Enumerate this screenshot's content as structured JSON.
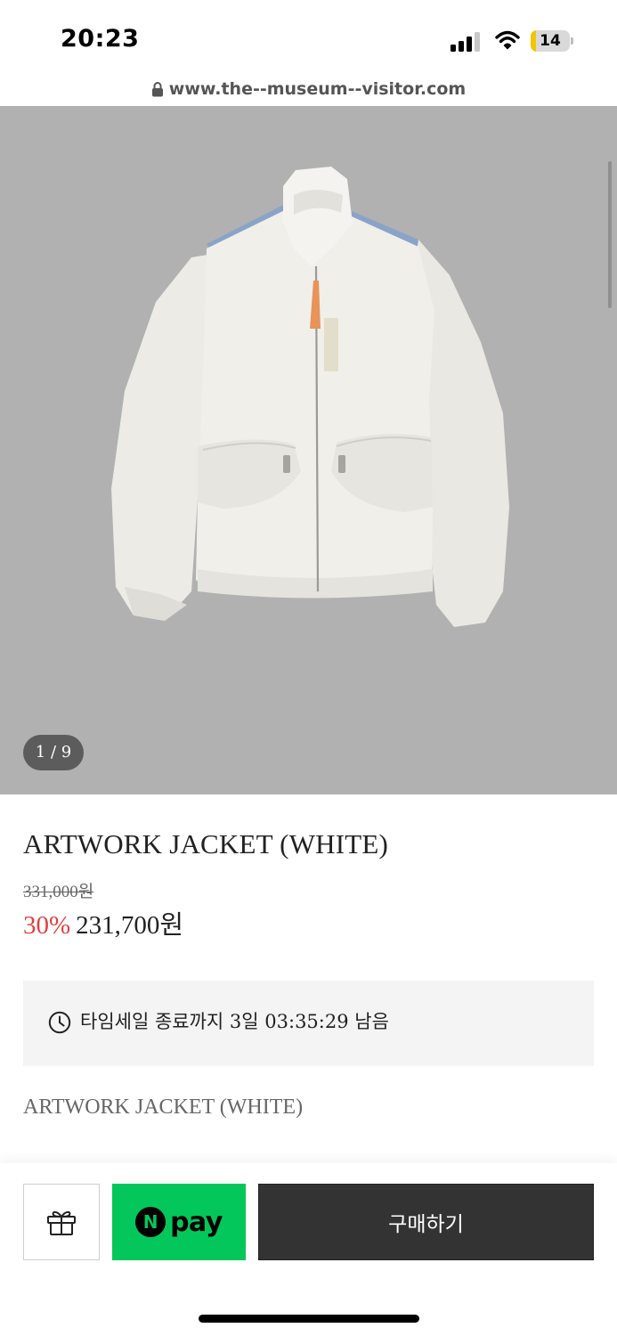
{
  "status_bar": {
    "time": "20:23",
    "battery_level": "14",
    "battery_fraction": 0.14,
    "battery_color": "#f2c500",
    "icons": [
      "signal-icon",
      "wifi-icon",
      "battery-icon"
    ]
  },
  "browser": {
    "url": "www.the--museum--visitor.com",
    "icon": "lock-icon"
  },
  "gallery": {
    "indicator": "1 / 9",
    "background_color": "#b1b1b1"
  },
  "product": {
    "title": "ARTWORK JACKET (WHITE)",
    "original_price": "331,000원",
    "discount": "30%",
    "sale_price": "231,700원",
    "discount_color": "#e0413e"
  },
  "timer": {
    "icon": "clock-icon",
    "text": "타임세일 종료까지 3일 03:35:29 남음"
  },
  "description": {
    "title": "ARTWORK JACKET (WHITE)"
  },
  "bottom_bar": {
    "gift_icon": "gift-icon",
    "npay_badge": "N",
    "npay_label": "pay",
    "npay_color": "#03c75a",
    "buy_label": "구매하기"
  }
}
